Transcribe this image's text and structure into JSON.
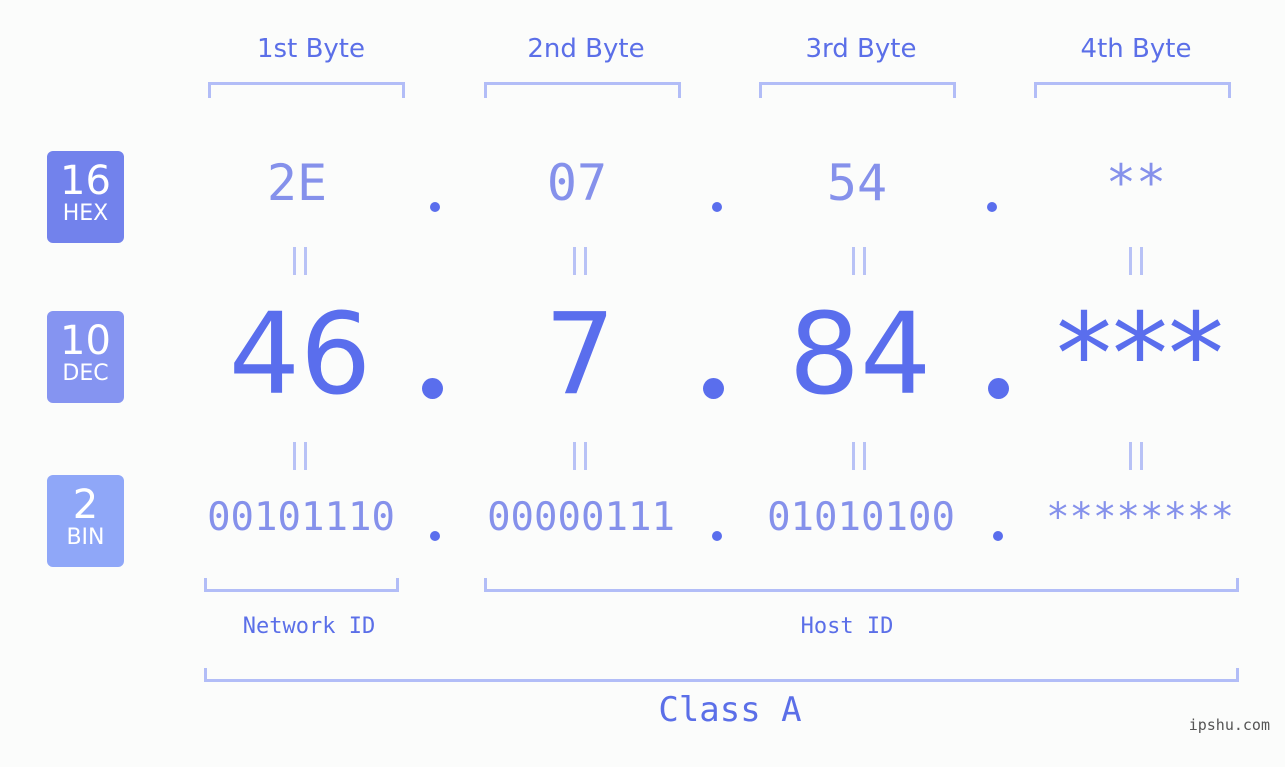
{
  "bytes": {
    "headers": [
      "1st Byte",
      "2nd Byte",
      "3rd Byte",
      "4th Byte"
    ]
  },
  "badges": {
    "hex": {
      "num": "16",
      "label": "HEX",
      "color": "#7282ec"
    },
    "dec": {
      "num": "10",
      "label": "DEC",
      "color": "#8594f1"
    },
    "bin": {
      "num": "2",
      "label": "BIN",
      "color": "#8fa7f8"
    }
  },
  "hex": [
    "2E",
    "07",
    "54",
    "**"
  ],
  "dec": [
    "46",
    "7",
    "84",
    "***"
  ],
  "bin": [
    "00101110",
    "00000111",
    "01010100",
    "********"
  ],
  "separator": ".",
  "labels": {
    "network_id": "Network ID",
    "host_id": "Host ID",
    "class": "Class A"
  },
  "watermark": "ipshu.com",
  "colors": {
    "accent": "#5a6eed",
    "light_accent": "#8591eb",
    "bracket": "#b2bdf7",
    "background": "#fbfcfb"
  }
}
